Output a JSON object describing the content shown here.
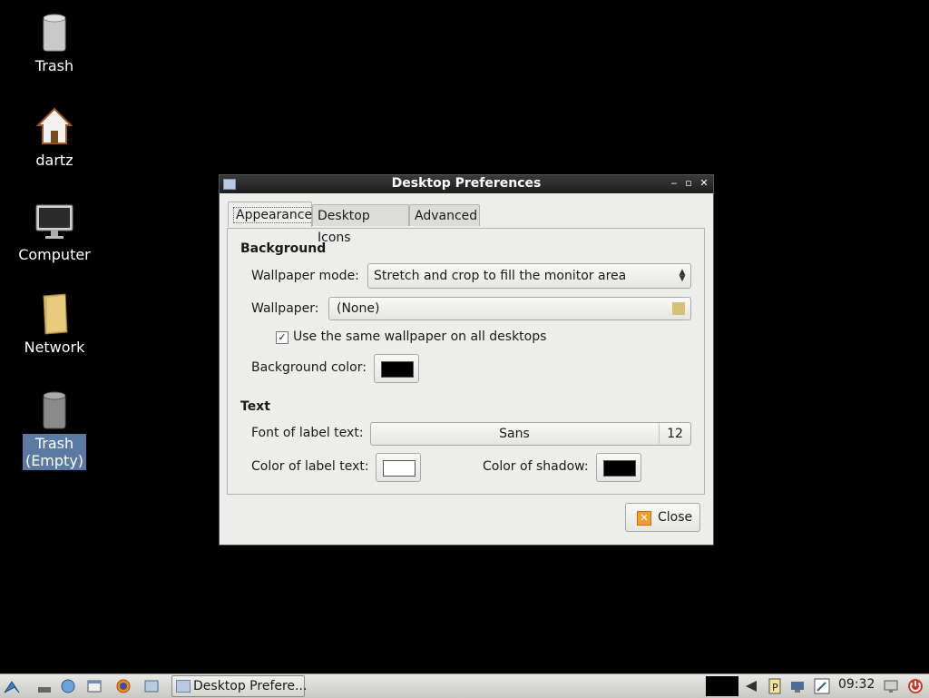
{
  "desktop": {
    "icons": [
      {
        "label": "Trash",
        "icon": "trash-icon"
      },
      {
        "label": "dartz",
        "icon": "home-icon"
      },
      {
        "label": "Computer",
        "icon": "computer-icon"
      },
      {
        "label": "Network",
        "icon": "network-folder-icon"
      },
      {
        "label": "Trash\n(Empty)",
        "label_line1": "Trash",
        "label_line2": "(Empty)",
        "icon": "trash-icon",
        "selected": true
      }
    ]
  },
  "window": {
    "title": "Desktop Preferences",
    "controls": {
      "minimize": "‒",
      "maximize": "▫",
      "close": "✕"
    },
    "tabs": [
      {
        "label": "Appearance",
        "active": true
      },
      {
        "label": "Desktop Icons",
        "active": false
      },
      {
        "label": "Advanced",
        "active": false
      }
    ],
    "background": {
      "heading": "Background",
      "wallpaper_mode_label": "Wallpaper mode:",
      "wallpaper_mode_value": "Stretch and crop to fill the monitor area",
      "wallpaper_label": "Wallpaper:",
      "wallpaper_value": "(None)",
      "same_wallpaper_label": "Use the same wallpaper on all desktops",
      "same_wallpaper_checked": true,
      "background_color_label": "Background color:",
      "background_color": "#000000"
    },
    "text": {
      "heading": "Text",
      "font_label": "Font of label text:",
      "font_name": "Sans",
      "font_size": "12",
      "label_color_label": "Color of label text:",
      "label_color": "#ffffff",
      "shadow_label": "Color of shadow:",
      "shadow_color": "#000000"
    },
    "close_label": "Close"
  },
  "taskbar": {
    "task_label": "Desktop Prefere...",
    "clock": "09:32"
  }
}
